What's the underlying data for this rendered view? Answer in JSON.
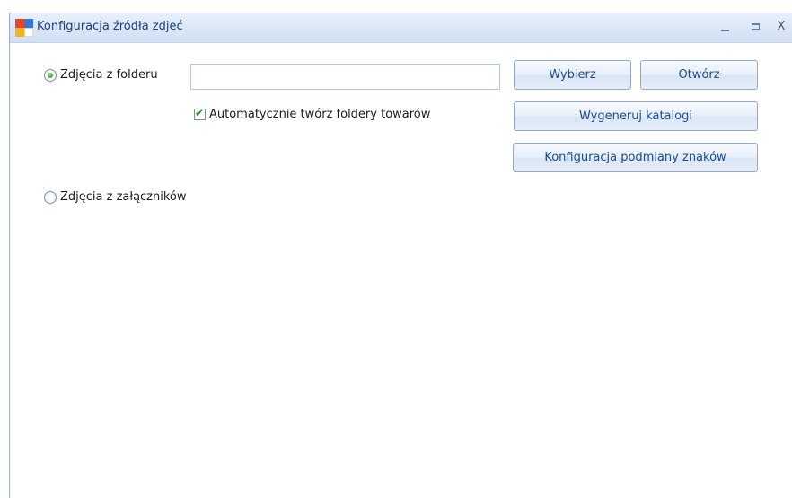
{
  "window": {
    "title": "Konfiguracja źródła zdjeć",
    "controls": {
      "close_label": "X"
    }
  },
  "source": {
    "folder_option_label": "Zdjęcia z folderu",
    "folder_option_selected": true,
    "folder_path_value": "",
    "auto_create_label": "Automatycznie twórz foldery towarów",
    "auto_create_checked": true,
    "attachments_option_label": "Zdjęcia z załączników",
    "attachments_option_selected": false
  },
  "buttons": {
    "choose_label": "Wybierz",
    "open_label": "Otwórz",
    "generate_label": "Wygeneruj katalogi",
    "char_config_label": "Konfiguracja podmiany znaków"
  },
  "icons": {
    "app_icon": "app-grid-icon",
    "minimize": "minimize-icon",
    "maximize": "maximize-icon",
    "close": "close-icon",
    "check": "check-icon"
  },
  "colors": {
    "title_text": "#1a3f82",
    "button_text": "#1c4c8c",
    "radio_selected": "#2e9a22",
    "check_mark": "#2e8b22"
  }
}
